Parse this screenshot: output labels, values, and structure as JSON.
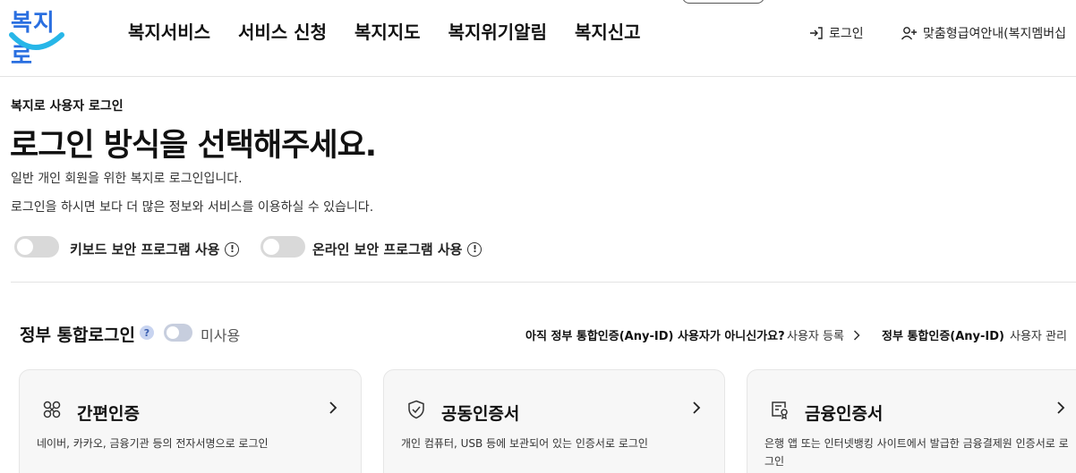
{
  "header": {
    "logo_text": "복지로",
    "nav": [
      "복지서비스",
      "서비스 신청",
      "복지지도",
      "복지위기알림",
      "복지신고"
    ],
    "login_label": "로그인",
    "guide_label": "맞춤형급여안내(복지멤버십"
  },
  "intro": {
    "subtitle": "복지로 사용자 로그인",
    "title": "로그인 방식을 선택해주세요.",
    "desc1": "일반 개인 회원을 위한 복지로 로그인입니다.",
    "desc2": "로그인을 하시면 보다 더 많은 정보와 서비스를 이용하실 수 있습니다.",
    "keyboard_security": "키보드 보안 프로그램 사용",
    "online_security": "온라인 보안 프로그램 사용"
  },
  "gov": {
    "title": "정부 통합로그인",
    "help": "?",
    "state": "미사용",
    "question": "아직 정부 통합인증(Any-ID) 사용자가 아니신가요?",
    "register": "사용자 등록",
    "anyid": "정부 통합인증(Any-ID)",
    "manage": "사용자 관리"
  },
  "cards": [
    {
      "title": "간편인증",
      "desc": "네이버, 카카오, 금융기관 등의 전자서명으로 로그인",
      "icon": "simple-auth-icon"
    },
    {
      "title": "공동인증서",
      "desc": "개인 컴퓨터, USB 등에 보관되어 있는 인증서로 로그인",
      "icon": "shield-check-icon"
    },
    {
      "title": "금융인증서",
      "desc": "은행 앱 또는 인터넷뱅킹 사이트에서 발급한 금융결제원 인증서로 로그인",
      "icon": "certificate-icon"
    }
  ],
  "colors": {
    "brand_blue": "#2a6fe0",
    "smile_cyan": "#27b6e8",
    "toggle_off": "#d9d9d9"
  }
}
